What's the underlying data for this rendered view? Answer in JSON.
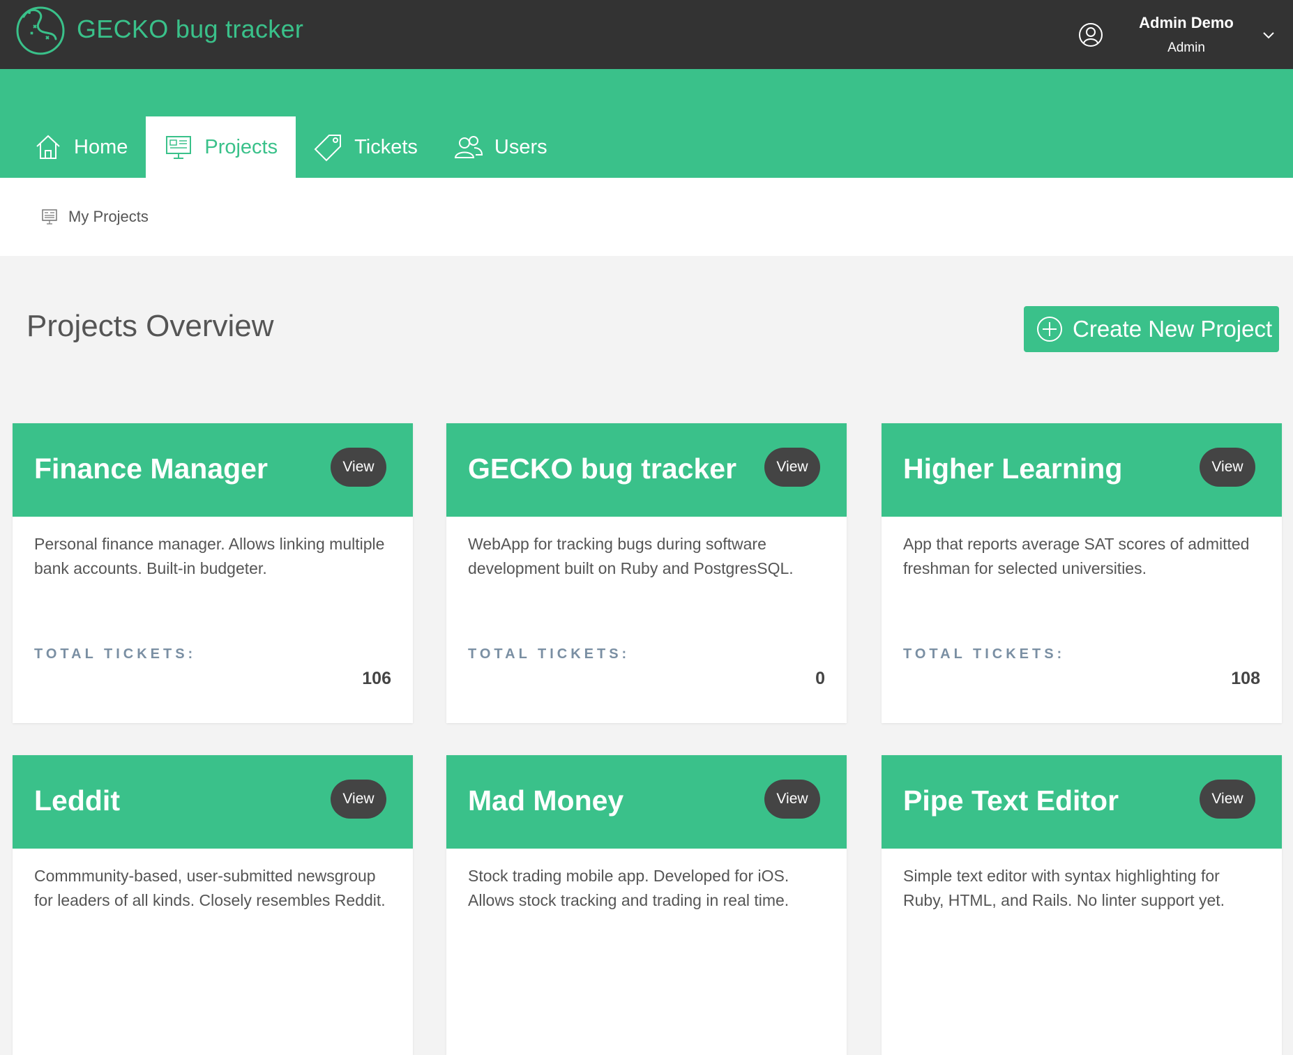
{
  "header": {
    "brand": "GECKO bug tracker",
    "user_name": "Admin Demo",
    "user_role": "Admin"
  },
  "nav": {
    "tabs": [
      {
        "label": "Home",
        "icon": "home-icon"
      },
      {
        "label": "Projects",
        "icon": "presentation-board-icon",
        "active": true
      },
      {
        "label": "Tickets",
        "icon": "tag-icon"
      },
      {
        "label": "Users",
        "icon": "users-icon"
      }
    ]
  },
  "breadcrumb": {
    "label": "My Projects"
  },
  "overview": {
    "title": "Projects Overview",
    "create_label": "Create New Project"
  },
  "projects": [
    {
      "title": "Finance Manager",
      "view_label": "View",
      "description": "Personal finance manager. Allows linking multiple bank accounts. Built-in budgeter.",
      "tickets_label": "TOTAL TICKETS:",
      "tickets": "106"
    },
    {
      "title": "GECKO bug tracker",
      "view_label": "View",
      "description": "WebApp for tracking bugs during software development built on Ruby and PostgresSQL.",
      "tickets_label": "TOTAL TICKETS:",
      "tickets": "0"
    },
    {
      "title": "Higher Learning",
      "view_label": "View",
      "description": "App that reports average SAT scores of admitted freshman for selected universities.",
      "tickets_label": "TOTAL TICKETS:",
      "tickets": "108"
    },
    {
      "title": "Leddit",
      "view_label": "View",
      "description": "Commmunity-based, user-submitted newsgroup for leaders of all kinds. Closely resembles Reddit.",
      "tickets_label": "",
      "tickets": ""
    },
    {
      "title": "Mad Money",
      "view_label": "View",
      "description": "Stock trading mobile app. Developed for iOS. Allows stock tracking and trading in real time.",
      "tickets_label": "",
      "tickets": ""
    },
    {
      "title": "Pipe Text Editor",
      "view_label": "View",
      "description": "Simple text editor with syntax highlighting for Ruby, HTML, and Rails. No linter support yet.",
      "tickets_label": "",
      "tickets": ""
    }
  ],
  "colors": {
    "topbar": "#333333",
    "accent": "#3ac18a",
    "view_button": "#444444",
    "tickets_label": "#7a8fa3"
  }
}
